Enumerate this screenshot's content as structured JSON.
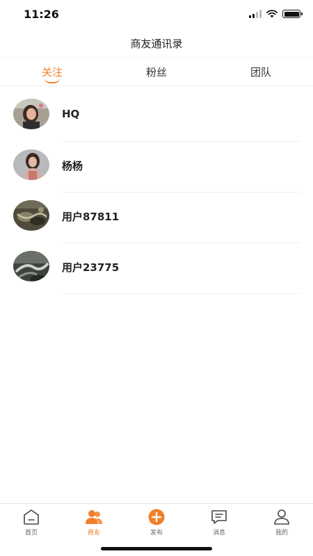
{
  "status_bar": {
    "time": "11:26",
    "icons": [
      "signal-icon",
      "wifi-icon",
      "battery-icon"
    ]
  },
  "header": {
    "title": "商友通讯录"
  },
  "tabs": [
    {
      "label": "关注",
      "active": true
    },
    {
      "label": "粉丝",
      "active": false
    },
    {
      "label": "团队",
      "active": false
    }
  ],
  "contacts": [
    {
      "name": "HQ",
      "avatar": "photo"
    },
    {
      "name": "杨杨",
      "avatar": "photo"
    },
    {
      "name": "用户87811",
      "avatar": "photo"
    },
    {
      "name": "用户23775",
      "avatar": "photo"
    }
  ],
  "bottom_nav": [
    {
      "label": "首页",
      "icon": "home-icon",
      "active": false
    },
    {
      "label": "商友",
      "icon": "friends-icon",
      "active": true
    },
    {
      "label": "发布",
      "icon": "plus-circle-icon",
      "active": false
    },
    {
      "label": "消息",
      "icon": "message-icon",
      "active": false
    },
    {
      "label": "我的",
      "icon": "user-icon",
      "active": false
    }
  ],
  "colors": {
    "accent": "#f07f2a",
    "text": "#222222",
    "divider": "#eeeeee"
  }
}
